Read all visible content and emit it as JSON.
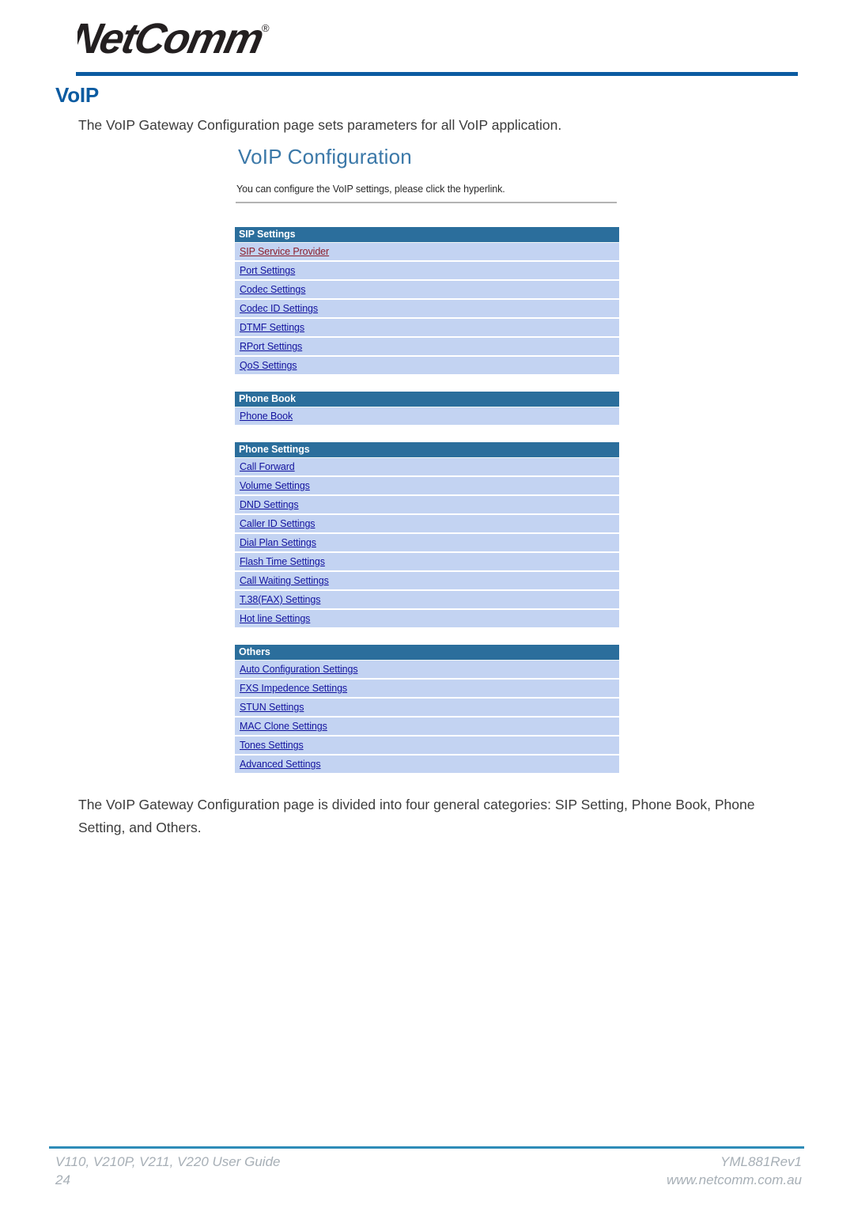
{
  "document": {
    "brand": "NetComm",
    "brand_mark": "registered-trademark",
    "page_title": "VoIP",
    "intro_text": "The VoIP Gateway Configuration page sets parameters for all VoIP application.",
    "body_text": "The VoIP Gateway Configuration page is divided into four general categories: SIP Setting, Phone Book, Phone Setting, and Others."
  },
  "colors": {
    "brand_blue": "#0b5ba1",
    "panel_header_blue": "#2b6e9c",
    "panel_row_blue": "#c3d3f2",
    "link_blue": "#13139e",
    "link_visited": "#8c1f2b",
    "shot_title_blue": "#3b78a8",
    "footer_rule": "#2f8cb8",
    "footer_text": "#a7afb6"
  },
  "screenshot": {
    "title": "VoIP Configuration",
    "subtitle": "You can configure the VoIP settings, please click the hyperlink.",
    "panels": [
      {
        "header": "SIP Settings",
        "rows": [
          {
            "label": "SIP Service Provider",
            "visited": true
          },
          {
            "label": "Port Settings",
            "visited": false
          },
          {
            "label": "Codec Settings",
            "visited": false
          },
          {
            "label": "Codec ID Settings",
            "visited": false
          },
          {
            "label": "DTMF Settings",
            "visited": false
          },
          {
            "label": "RPort Settings",
            "visited": false
          },
          {
            "label": "QoS Settings",
            "visited": false
          }
        ]
      },
      {
        "header": "Phone Book",
        "rows": [
          {
            "label": "Phone Book",
            "visited": false
          }
        ]
      },
      {
        "header": "Phone Settings",
        "rows": [
          {
            "label": "Call Forward",
            "visited": false
          },
          {
            "label": "Volume Settings",
            "visited": false
          },
          {
            "label": "DND Settings",
            "visited": false
          },
          {
            "label": "Caller ID Settings",
            "visited": false
          },
          {
            "label": "Dial Plan Settings",
            "visited": false
          },
          {
            "label": "Flash Time Settings",
            "visited": false
          },
          {
            "label": "Call Waiting Settings",
            "visited": false
          },
          {
            "label": "T.38(FAX) Settings",
            "visited": false
          },
          {
            "label": "Hot line Settings",
            "visited": false
          }
        ]
      },
      {
        "header": "Others",
        "rows": [
          {
            "label": "Auto Configuration Settings",
            "visited": false
          },
          {
            "label": "FXS Impedence Settings",
            "visited": false
          },
          {
            "label": "STUN Settings",
            "visited": false
          },
          {
            "label": "MAC Clone Settings",
            "visited": false
          },
          {
            "label": "Tones Settings",
            "visited": false
          },
          {
            "label": "Advanced Settings",
            "visited": false
          }
        ]
      }
    ]
  },
  "footer": {
    "guide": "V110, V210P, V211, V220 User Guide",
    "page_number": "24",
    "doc_id": "YML881Rev1",
    "website": "www.netcomm.com.au"
  }
}
